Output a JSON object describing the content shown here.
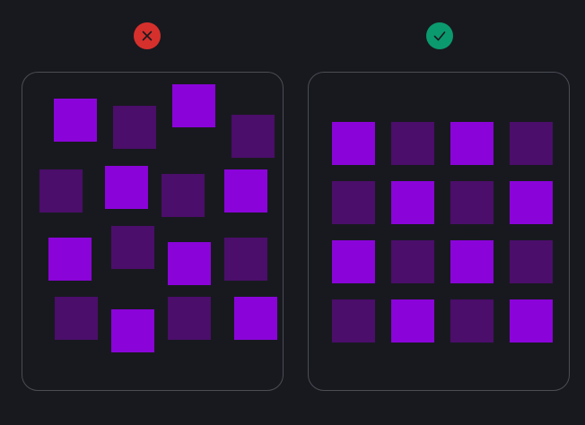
{
  "colors": {
    "background": "#18191f",
    "panel_border": "#4b4d55",
    "tile_bright": "#8a04d9",
    "tile_dim": "#4b0e6a",
    "bad_badge": "#d6302c",
    "good_badge": "#0b9a6d",
    "badge_mark": "#18191f"
  },
  "icons": {
    "bad": "cross-icon",
    "good": "check-icon"
  },
  "grids": {
    "bad": [
      [
        "bright",
        "dim",
        "bright",
        "dim"
      ],
      [
        "dim",
        "bright",
        "dim",
        "bright"
      ],
      [
        "bright",
        "dim",
        "bright",
        "dim"
      ],
      [
        "dim",
        "bright",
        "dim",
        "bright"
      ]
    ],
    "good": [
      [
        "bright",
        "dim",
        "bright",
        "dim"
      ],
      [
        "dim",
        "bright",
        "dim",
        "bright"
      ],
      [
        "bright",
        "dim",
        "bright",
        "dim"
      ],
      [
        "dim",
        "bright",
        "dim",
        "bright"
      ]
    ]
  }
}
